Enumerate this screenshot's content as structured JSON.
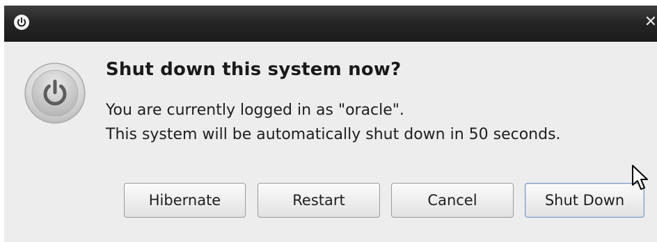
{
  "window": {
    "icon": "power-icon",
    "close_label": "✕"
  },
  "dialog": {
    "icon": "power-button-icon",
    "heading": "Shut down this system now?",
    "message_line1": "You are currently logged in as \"oracle\".",
    "message_line2": "This system will be automatically shut down in 50 seconds."
  },
  "buttons": {
    "hibernate": "Hibernate",
    "restart": "Restart",
    "cancel": "Cancel",
    "shutdown": "Shut Down"
  },
  "colors": {
    "titlebar": "#262626",
    "dialog_bg": "#ededed",
    "default_button_border": "#7c98bf"
  }
}
